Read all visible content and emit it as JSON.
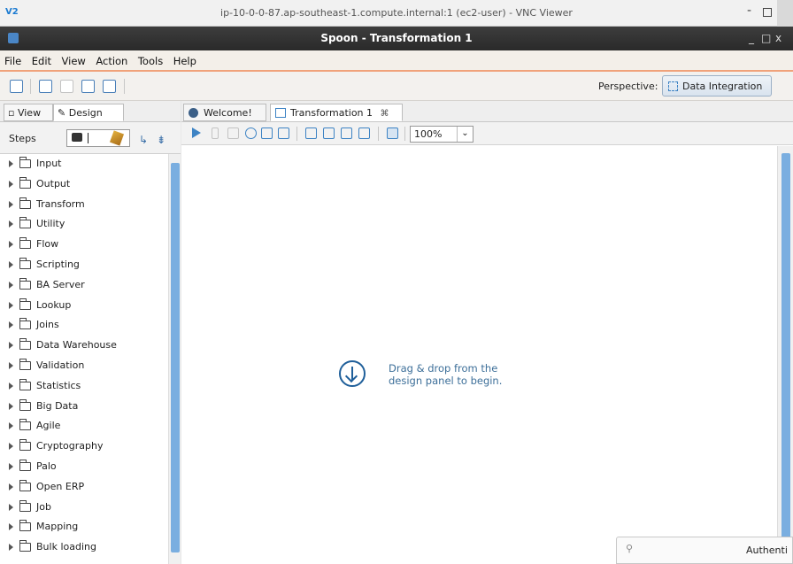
{
  "vnc": {
    "logo": "V2",
    "title": "ip-10-0-0-87.ap-southeast-1.compute.internal:1 (ec2-user) - VNC Viewer",
    "minimize": "-"
  },
  "spoon": {
    "title": "Spoon - Transformation 1",
    "min": "_",
    "max": "□",
    "close": "x"
  },
  "menu": [
    "File",
    "Edit",
    "View",
    "Action",
    "Tools",
    "Help"
  ],
  "toolbar": {
    "perspective_label": "Perspective:",
    "perspective_value": "Data Integration"
  },
  "left_panel": {
    "tabs": [
      "View",
      "Design"
    ],
    "steps_label": "Steps",
    "categories": [
      "Input",
      "Output",
      "Transform",
      "Utility",
      "Flow",
      "Scripting",
      "BA Server",
      "Lookup",
      "Joins",
      "Data Warehouse",
      "Validation",
      "Statistics",
      "Big Data",
      "Agile",
      "Cryptography",
      "Palo",
      "Open ERP",
      "Job",
      "Mapping",
      "Bulk loading"
    ]
  },
  "editor": {
    "tabs": [
      {
        "label": "Welcome!"
      },
      {
        "label": "Transformation 1",
        "close": "⌘"
      }
    ],
    "zoom": "100%",
    "zoom_arrow": "⌄",
    "hint": "Drag & drop from the design panel to begin."
  },
  "auth_popup": {
    "title": "Authenti"
  }
}
